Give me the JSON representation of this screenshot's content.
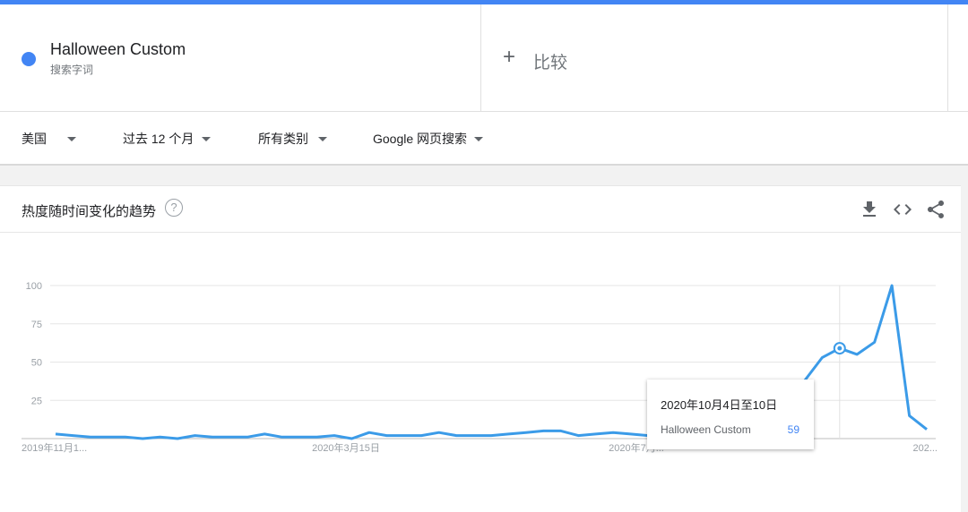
{
  "term": {
    "name": "Halloween Custom",
    "subtitle": "搜索字词",
    "color": "#4285f4"
  },
  "compare": {
    "label": "比较"
  },
  "filters": [
    {
      "label": "美国"
    },
    {
      "label": "过去 12 个月"
    },
    {
      "label": "所有类别"
    },
    {
      "label": "Google 网页搜索"
    }
  ],
  "card": {
    "title": "热度随时间变化的趋势",
    "help_icon": "question-circle-icon",
    "actions": [
      "download-icon",
      "embed-code-icon",
      "share-icon"
    ]
  },
  "tooltip": {
    "date": "2020年10月4日至10日",
    "series": "Halloween Custom",
    "value": "59"
  },
  "chart_data": {
    "type": "line",
    "series": [
      {
        "name": "Halloween Custom",
        "color": "#3b9be8",
        "values": [
          3,
          2,
          1,
          1,
          1,
          0,
          1,
          0,
          2,
          1,
          1,
          1,
          3,
          1,
          1,
          1,
          2,
          0,
          4,
          2,
          2,
          2,
          4,
          2,
          2,
          2,
          3,
          4,
          5,
          5,
          2,
          3,
          4,
          3,
          2,
          5,
          8,
          6,
          10,
          12,
          17,
          25,
          30,
          38,
          53,
          59,
          55,
          63,
          100,
          15,
          6
        ]
      }
    ],
    "x_tick_labels": [
      "2019年11月1...",
      "2020年3月15日",
      "2020年7月...",
      "202..."
    ],
    "y_ticks": [
      25,
      50,
      75,
      100
    ],
    "ylim": [
      0,
      100
    ],
    "grid": true,
    "highlight_index": 45
  }
}
